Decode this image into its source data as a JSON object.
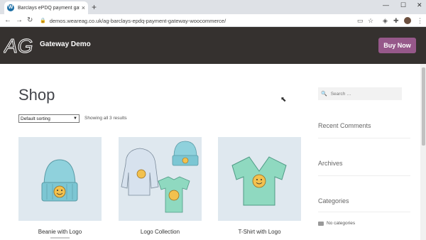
{
  "browser": {
    "tab_title": "Barclays ePDQ payment gatewa…",
    "url": "demos.weareag.co.uk/ag-barclays-epdq-payment-gateway-woocommerce/"
  },
  "site": {
    "title": "Gateway Demo",
    "buy_now": "Buy Now",
    "logo_text": "AG"
  },
  "shop": {
    "title": "Shop",
    "sorting": "Default sorting",
    "result_count": "Showing all 3 results",
    "products": [
      {
        "name": "Beanie with Logo"
      },
      {
        "name": "Logo Collection"
      },
      {
        "name": "T-Shirt with Logo"
      }
    ]
  },
  "sidebar": {
    "search_placeholder": "Search …",
    "widgets": [
      "Recent Comments",
      "Archives",
      "Categories"
    ],
    "no_categories": "No categories"
  },
  "colors": {
    "header_bg": "#35312f",
    "button": "#96588a",
    "product_bg": "#dfe8ef"
  }
}
